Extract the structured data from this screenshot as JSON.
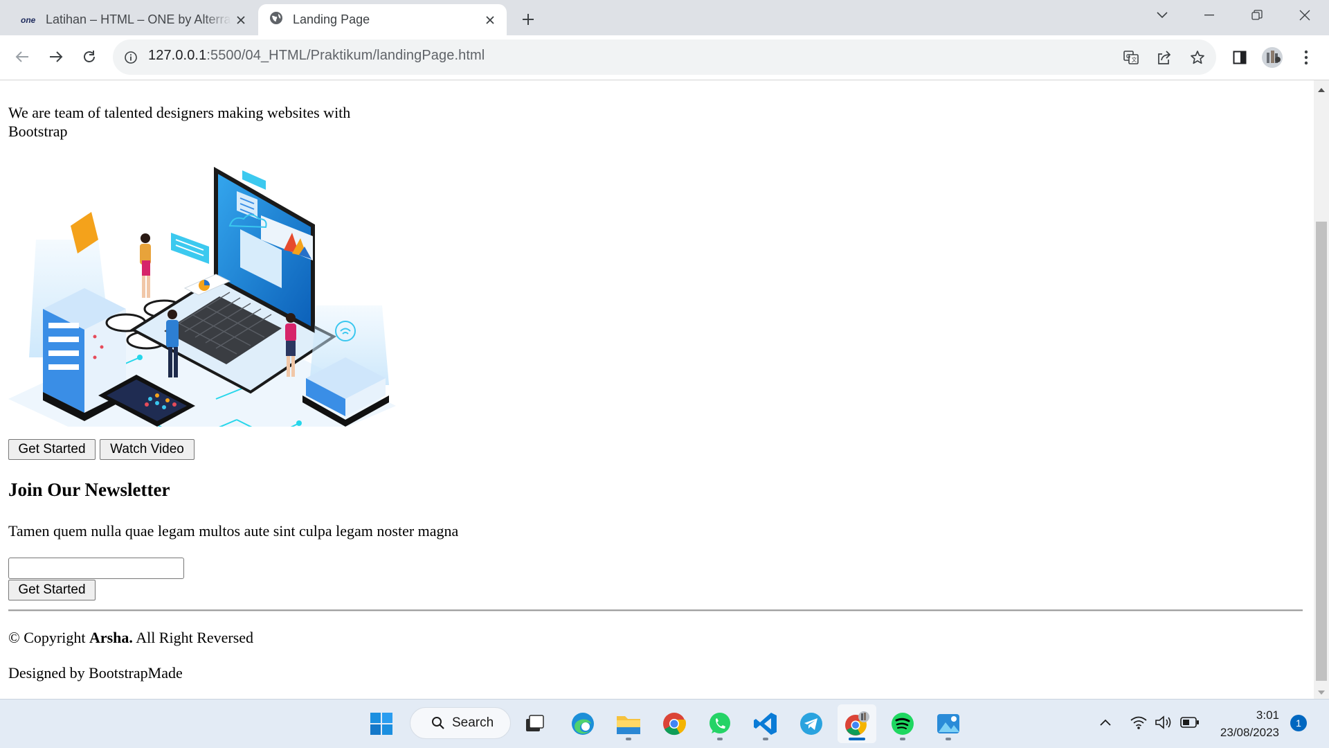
{
  "browser": {
    "tabs": [
      {
        "title": "Latihan – HTML – ONE by Alterra",
        "favicon": "one",
        "active": false
      },
      {
        "title": "Landing Page",
        "favicon": "globe-icon",
        "active": true
      }
    ],
    "address_bar": {
      "host": "127.0.0.1",
      "path": ":5500/04_HTML/Praktikum/landingPage.html"
    }
  },
  "page": {
    "hero_text": "We are team of talented designers making websites with Bootstrap",
    "buttons": {
      "get_started": "Get Started",
      "watch_video": "Watch Video"
    },
    "newsletter": {
      "title": "Join Our Newsletter",
      "text": "Tamen quem nulla quae legam multos aute sint culpa legam noster magna",
      "email_value": "",
      "submit": "Get Started"
    },
    "footer": {
      "copyright_prefix": "© Copyright ",
      "brand": "Arsha.",
      "copyright_suffix": " All Right Reversed",
      "designed_by": "Designed by BootstrapMade"
    }
  },
  "taskbar": {
    "search_label": "Search",
    "apps": [
      "windows-start-icon",
      "search",
      "task-view-icon",
      "edge-icon",
      "file-explorer-icon",
      "chrome-icon",
      "whatsapp-icon",
      "vscode-icon",
      "telegram-icon",
      "chrome-profile-icon",
      "spotify-icon",
      "photos-icon"
    ],
    "time": "3:01",
    "date": "23/08/2023",
    "notification_count": "1"
  },
  "colors": {
    "tabstrip": "#dee1e6",
    "taskbar": "#e3ebf5",
    "accent_blue": "#0067c0"
  }
}
